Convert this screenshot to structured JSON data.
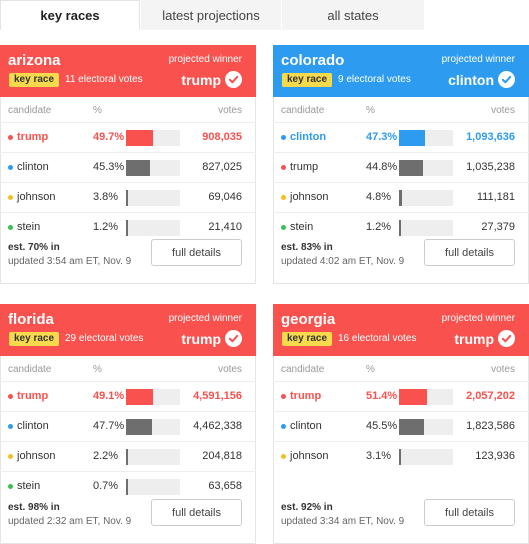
{
  "tabs": [
    {
      "label": "key races",
      "active": true
    },
    {
      "label": "latest projections",
      "active": false
    },
    {
      "label": "all states",
      "active": false
    }
  ],
  "colors": {
    "trump": "#f9514e",
    "clinton": "#2d9bf0",
    "johnson": "#f5bf23",
    "stein": "#3cbf52",
    "bar_other": "#6e6e6e",
    "key_race_badge": "#f7d94c"
  },
  "columns": {
    "candidate": "candidate",
    "pct": "%",
    "votes": "votes"
  },
  "projected_winner_label": "projected winner",
  "key_race_label": "key race",
  "full_details_label": "full details",
  "races": [
    {
      "state": "arizona",
      "electoral_votes": "11 electoral votes",
      "winner": "trump",
      "winner_color": "#f9514e",
      "candidates": [
        {
          "name": "trump",
          "pct": "49.7%",
          "pct_value": 49.7,
          "votes": "908,035",
          "color": "#f9514e",
          "lead": true
        },
        {
          "name": "clinton",
          "pct": "45.3%",
          "pct_value": 45.3,
          "votes": "827,025",
          "color": "#2d9bf0",
          "lead": false
        },
        {
          "name": "johnson",
          "pct": "3.8%",
          "pct_value": 3.8,
          "votes": "69,046",
          "color": "#f5bf23",
          "lead": false
        },
        {
          "name": "stein",
          "pct": "1.2%",
          "pct_value": 1.2,
          "votes": "21,410",
          "color": "#3cbf52",
          "lead": false
        }
      ],
      "est_in": "est. 70% in",
      "updated": "updated 3:54 am ET, Nov. 9"
    },
    {
      "state": "colorado",
      "electoral_votes": "9 electoral votes",
      "winner": "clinton",
      "winner_color": "#2d9bf0",
      "candidates": [
        {
          "name": "clinton",
          "pct": "47.3%",
          "pct_value": 47.3,
          "votes": "1,093,636",
          "color": "#2d9bf0",
          "lead": true
        },
        {
          "name": "trump",
          "pct": "44.8%",
          "pct_value": 44.8,
          "votes": "1,035,238",
          "color": "#f9514e",
          "lead": false
        },
        {
          "name": "johnson",
          "pct": "4.8%",
          "pct_value": 4.8,
          "votes": "111,181",
          "color": "#f5bf23",
          "lead": false
        },
        {
          "name": "stein",
          "pct": "1.2%",
          "pct_value": 1.2,
          "votes": "27,379",
          "color": "#3cbf52",
          "lead": false
        }
      ],
      "est_in": "est. 83% in",
      "updated": "updated 4:02 am ET, Nov. 9"
    },
    {
      "state": "florida",
      "electoral_votes": "29 electoral votes",
      "winner": "trump",
      "winner_color": "#f9514e",
      "candidates": [
        {
          "name": "trump",
          "pct": "49.1%",
          "pct_value": 49.1,
          "votes": "4,591,156",
          "color": "#f9514e",
          "lead": true
        },
        {
          "name": "clinton",
          "pct": "47.7%",
          "pct_value": 47.7,
          "votes": "4,462,338",
          "color": "#2d9bf0",
          "lead": false
        },
        {
          "name": "johnson",
          "pct": "2.2%",
          "pct_value": 2.2,
          "votes": "204,818",
          "color": "#f5bf23",
          "lead": false
        },
        {
          "name": "stein",
          "pct": "0.7%",
          "pct_value": 0.7,
          "votes": "63,658",
          "color": "#3cbf52",
          "lead": false
        }
      ],
      "est_in": "est. 98% in",
      "updated": "updated 2:32 am ET, Nov. 9"
    },
    {
      "state": "georgia",
      "electoral_votes": "16 electoral votes",
      "winner": "trump",
      "winner_color": "#f9514e",
      "candidates": [
        {
          "name": "trump",
          "pct": "51.4%",
          "pct_value": 51.4,
          "votes": "2,057,202",
          "color": "#f9514e",
          "lead": true
        },
        {
          "name": "clinton",
          "pct": "45.5%",
          "pct_value": 45.5,
          "votes": "1,823,586",
          "color": "#2d9bf0",
          "lead": false
        },
        {
          "name": "johnson",
          "pct": "3.1%",
          "pct_value": 3.1,
          "votes": "123,936",
          "color": "#f5bf23",
          "lead": false
        }
      ],
      "est_in": "est. 92% in",
      "updated": "updated 3:34 am ET, Nov. 9"
    }
  ]
}
